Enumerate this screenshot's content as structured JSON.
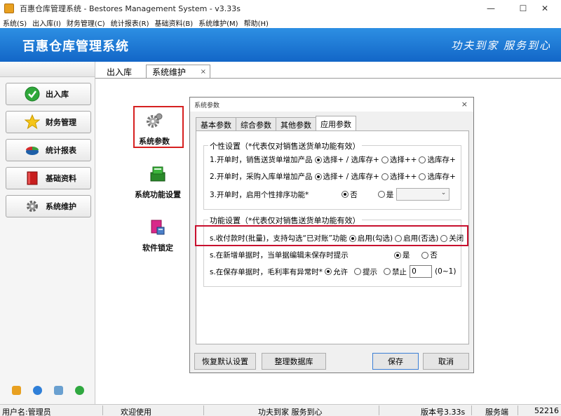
{
  "window": {
    "title": "百惠仓库管理系统 - Bestores Management System - v3.33s",
    "minimize": "—",
    "maximize": "☐",
    "close": "✕"
  },
  "menu": [
    "系统(S)",
    "出入库(I)",
    "财务管理(C)",
    "统计报表(R)",
    "基础资料(B)",
    "系统维护(M)",
    "帮助(H)"
  ],
  "header": {
    "title": "百惠仓库管理系统",
    "slogan": "功夫到家 服务到心"
  },
  "sidebar": {
    "items": [
      {
        "label": "出入库",
        "icon": "check-circle-icon"
      },
      {
        "label": "财务管理",
        "icon": "star-icon"
      },
      {
        "label": "统计报表",
        "icon": "pie-chart-icon"
      },
      {
        "label": "基础资料",
        "icon": "book-icon"
      },
      {
        "label": "系统维护",
        "icon": "gear-icon"
      }
    ]
  },
  "tabs": {
    "tab1": "出入库",
    "tab2": "系统维护",
    "tab2_close": "×"
  },
  "main": {
    "items": [
      {
        "label": "系统参数",
        "icon": "gear-icon"
      },
      {
        "label": "系统功能设置",
        "icon": "function-settings-icon"
      },
      {
        "label": "软件锁定",
        "icon": "lock-icon"
      }
    ]
  },
  "dialog": {
    "title": "系统参数",
    "close": "×",
    "tabs": [
      "基本参数",
      "综合参数",
      "其他参数",
      "应用参数"
    ],
    "active_tab": "应用参数",
    "group1": {
      "title": "个性设置（*代表仅对销售送货单功能有效）",
      "row1": {
        "label": "1.开单时，销售送货单增加产品",
        "opt1": "选择+ / 选库存+",
        "opt2": "选择++",
        "opt3": "选库存+"
      },
      "row2": {
        "label": "2.开单时，采购入库单增加产品",
        "opt1": "选择+ / 选库存+",
        "opt2": "选择++",
        "opt3": "选库存+"
      },
      "row3": {
        "label": "3.开单时，启用个性排序功能*",
        "opt1": "否",
        "opt2": "是",
        "combo": "⌄"
      }
    },
    "group2": {
      "title": "功能设置（*代表仅对销售送货单功能有效）",
      "row1": {
        "label": "s.收付款时(批量)，支持勾选“已对账”功能",
        "opt1": "启用(勾选)",
        "opt2": "启用(否选)",
        "opt3": "关闭"
      },
      "row2": {
        "label": "s.在新增单据时，当单据编辑未保存时提示",
        "opt1": "是",
        "opt2": "否"
      },
      "row3": {
        "label": "s.在保存单据时，毛利率有异常时*",
        "opt1": "允许",
        "opt2": "提示",
        "opt3": "禁止",
        "value": "0",
        "range": "(0~1)"
      }
    },
    "buttons": {
      "restore": "恢复默认设置",
      "organize": "整理数据库",
      "save": "保存",
      "cancel": "取消"
    }
  },
  "status": {
    "user": "用户名:管理员",
    "welcome": "欢迎使用",
    "slogan": "功夫到家 服务到心",
    "version": "版本号3.33s",
    "server": "服务端",
    "port": "52216"
  }
}
